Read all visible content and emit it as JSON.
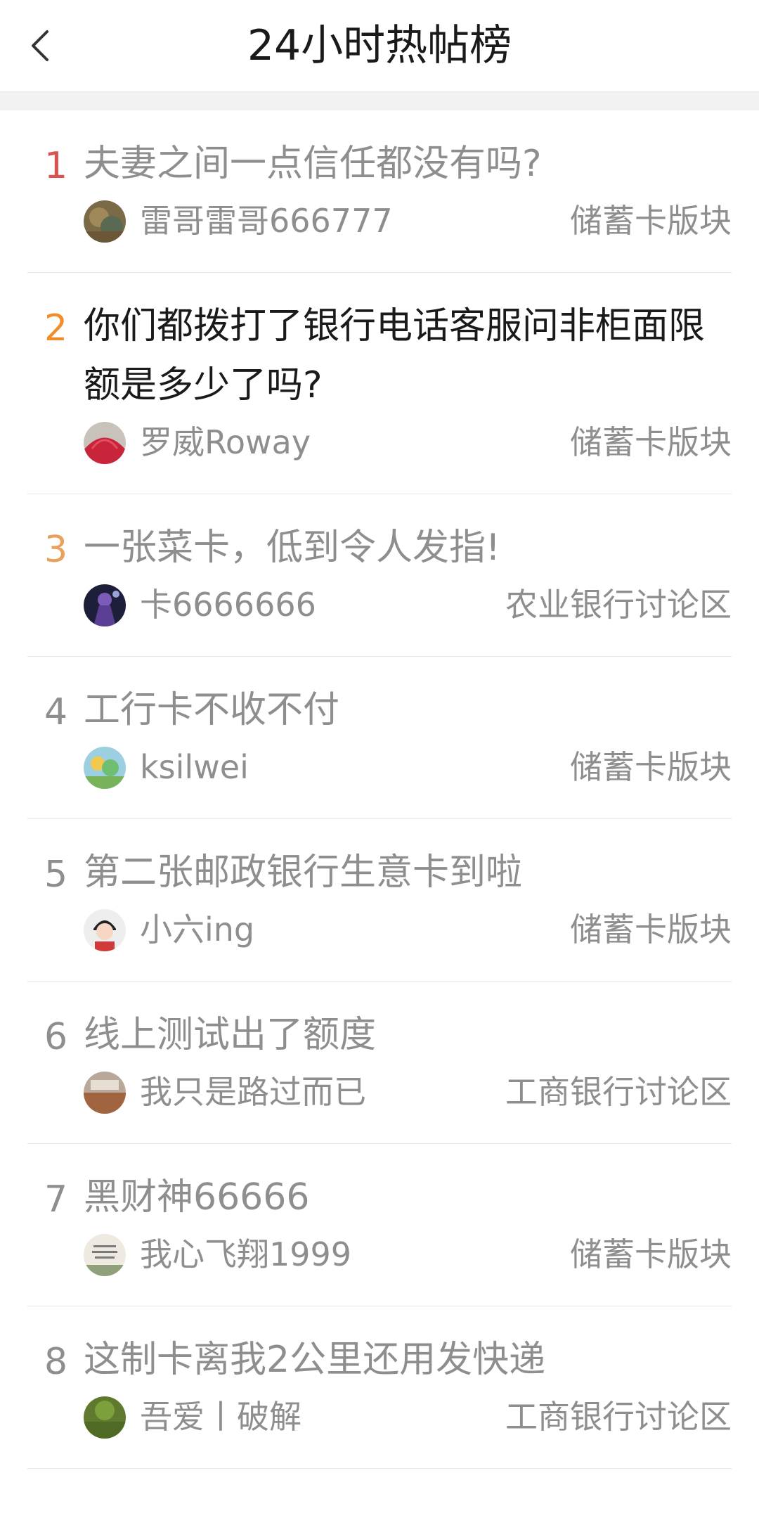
{
  "header": {
    "title": "24小时热帖榜",
    "back_icon": "chevron-left-icon"
  },
  "colors": {
    "rank1": "#d9534f",
    "rank2": "#f08c2a",
    "rank3": "#e8a05a",
    "rank_default": "#8e8e8e",
    "text_muted": "#8e8e8e",
    "text_dark": "#1a1a1a"
  },
  "posts": [
    {
      "rank": "1",
      "title": "夫妻之间一点信任都没有吗?",
      "author": "雷哥雷哥666777",
      "board": "储蓄卡版块"
    },
    {
      "rank": "2",
      "title": "你们都拨打了银行电话客服问非柜面限额是多少了吗?",
      "author": "罗威Roway",
      "board": "储蓄卡版块"
    },
    {
      "rank": "3",
      "title": "一张菜卡，低到令人发指!",
      "author": "卡6666666",
      "board": "农业银行讨论区"
    },
    {
      "rank": "4",
      "title": "工行卡不收不付",
      "author": "ksilwei",
      "board": "储蓄卡版块"
    },
    {
      "rank": "5",
      "title": "第二张邮政银行生意卡到啦",
      "author": "小六ing",
      "board": "储蓄卡版块"
    },
    {
      "rank": "6",
      "title": "线上测试出了额度",
      "author": "我只是路过而已",
      "board": "工商银行讨论区"
    },
    {
      "rank": "7",
      "title": "黑财神66666",
      "author": "我心飞翔1999",
      "board": "储蓄卡版块"
    },
    {
      "rank": "8",
      "title": "这制卡离我2公里还用发快递",
      "author": "吾爱丨破解",
      "board": "工商银行讨论区"
    }
  ]
}
